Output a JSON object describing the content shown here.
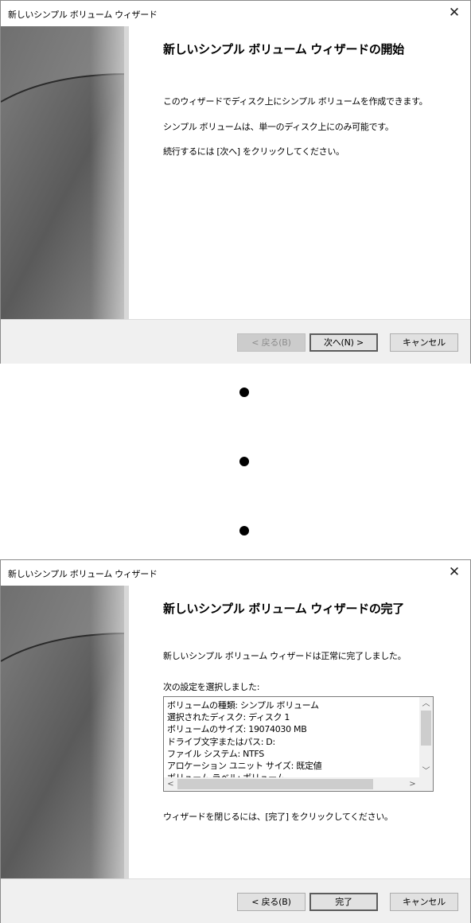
{
  "wizard_start": {
    "title": "新しいシンプル ボリューム ウィザード",
    "heading": "新しいシンプル ボリューム ウィザードの開始",
    "paragraphs": [
      "このウィザードでディスク上にシンプル ボリュームを作成できます。",
      "シンプル ボリュームは、単一のディスク上にのみ可能です。",
      "続行するには [次へ] をクリックしてください。"
    ],
    "buttons": {
      "back": "< 戻る(B)",
      "next": "次へ(N) >",
      "cancel": "キャンセル"
    },
    "close_icon": "close-icon"
  },
  "ellipsis_dots": [
    "dot",
    "dot",
    "dot"
  ],
  "wizard_finish": {
    "title": "新しいシンプル ボリューム ウィザード",
    "heading": "新しいシンプル ボリューム ウィザードの完了",
    "completed_text": "新しいシンプル ボリューム ウィザードは正常に完了しました。",
    "settings_label": "次の設定を選択しました:",
    "settings": [
      "ボリュームの種類: シンプル ボリューム",
      "選択されたディスク: ディスク 1",
      "ボリュームのサイズ: 19074030 MB",
      "ドライブ文字またはパス: D:",
      "ファイル システム: NTFS",
      "アロケーション ユニット サイズ: 既定値",
      "ボリューム ラベル: ボリューム"
    ],
    "close_hint": "ウィザードを閉じるには、[完了] をクリックしてください。",
    "buttons": {
      "back": "< 戻る(B)",
      "finish": "完了",
      "cancel": "キャンセル"
    }
  },
  "colors": {
    "footer": "#f0f0f0",
    "button": "#e1e1e1",
    "disabled_text": "#8d8d8d"
  }
}
